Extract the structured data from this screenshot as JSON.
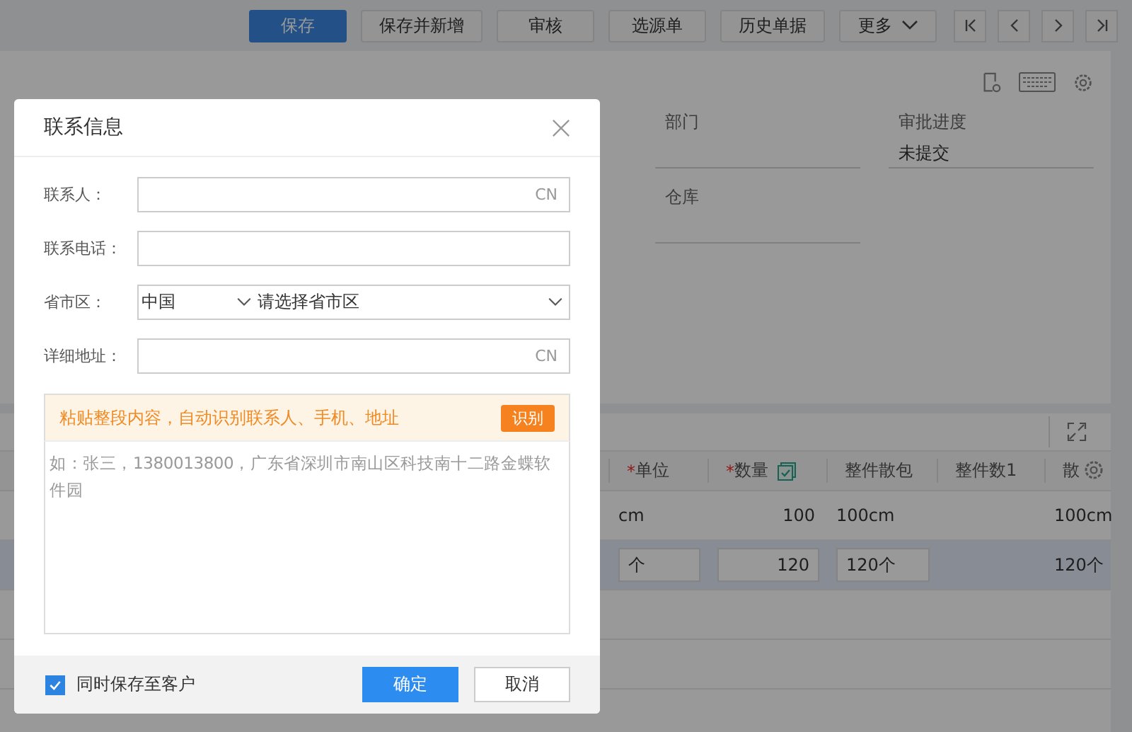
{
  "toolbar": {
    "buttons": [
      {
        "label": "保存",
        "kind": "primary"
      },
      {
        "label": "保存并新增",
        "kind": "default"
      },
      {
        "label": "审核",
        "kind": "default"
      },
      {
        "label": "选源单",
        "kind": "default"
      },
      {
        "label": "历史单据",
        "kind": "default"
      },
      {
        "label": "更多",
        "kind": "dropdown"
      }
    ]
  },
  "form": {
    "fields": [
      {
        "label": "部门"
      },
      {
        "label": "审批进度",
        "value": "未提交"
      },
      {
        "label": "仓库"
      }
    ]
  },
  "table": {
    "columns": [
      {
        "label": "单位",
        "mark": "*"
      },
      {
        "label": "数量",
        "mark": "*"
      },
      {
        "label": "整件散包"
      },
      {
        "label": "整件数1"
      },
      {
        "label": "散"
      }
    ],
    "rows": [
      {
        "selected": false,
        "unit": "cm",
        "quantity": "100",
        "pack": "100cm",
        "pack_2": "100cm"
      },
      {
        "selected": true,
        "unit": "个",
        "quantity": "120",
        "pack": "120个",
        "pack_2": "120个"
      }
    ]
  },
  "dialog": {
    "title": "联系信息",
    "fields": [
      {
        "kind": "text",
        "label": "联系人：",
        "suffix": "CN"
      },
      {
        "kind": "text",
        "label": "联系电话："
      },
      {
        "kind": "region",
        "label": "省市区：",
        "country": "中国",
        "placeholder": "请选择省市区"
      },
      {
        "kind": "text",
        "label": "详细地址：",
        "suffix": "CN"
      }
    ],
    "paste": {
      "hint": "粘贴整段内容，自动识别联系人、手机、地址",
      "button": "识别",
      "placeholder": "如：张三，1380013800，广东省深圳市南山区科技南十二路金蝶软件园"
    },
    "save_to_customer": {
      "label": "同时保存至客户",
      "checked": true
    },
    "buttons": [
      {
        "label": "确定",
        "kind": "primary"
      },
      {
        "label": "取消",
        "kind": "default"
      }
    ]
  }
}
